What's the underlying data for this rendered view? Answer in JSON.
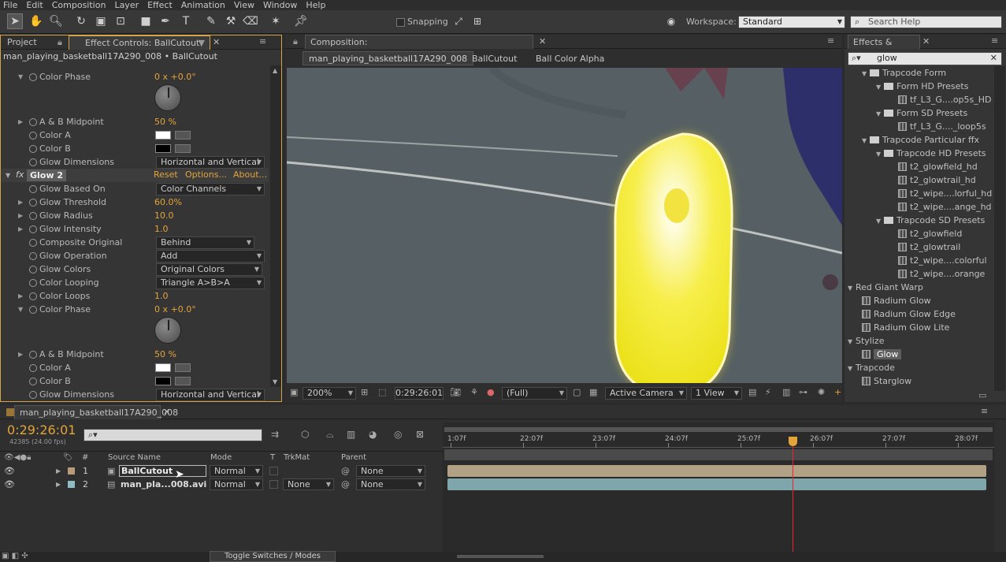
{
  "menu": [
    "File",
    "Edit",
    "Composition",
    "Layer",
    "Effect",
    "Animation",
    "View",
    "Window",
    "Help"
  ],
  "toolbar": {
    "snapping_label": "Snapping",
    "workspace_label": "Workspace:",
    "workspace_value": "Standard",
    "search_placeholder": "Search Help"
  },
  "effect_panel": {
    "tab_project": "Project",
    "tab_effect": "Effect Controls: BallCutout",
    "breadcrumb": "man_playing_basketball17A290_008 • BallCutout",
    "rows": [
      {
        "label": "Color Phase",
        "value": "0 x +0.0°"
      },
      {
        "label": "A & B Midpoint",
        "value": "50 %"
      },
      {
        "label": "Color A",
        "value": ""
      },
      {
        "label": "Color B",
        "value": ""
      },
      {
        "label": "Glow Dimensions",
        "value": "Horizontal and Vertical"
      }
    ],
    "glow2": {
      "name": "Glow 2",
      "reset": "Reset",
      "options": "Options...",
      "about": "About..."
    },
    "glow2_rows": [
      {
        "label": "Glow Based On",
        "value": "Color Channels"
      },
      {
        "label": "Glow Threshold",
        "value": "60.0%"
      },
      {
        "label": "Glow Radius",
        "value": "10.0"
      },
      {
        "label": "Glow Intensity",
        "value": "1.0"
      },
      {
        "label": "Composite Original",
        "value": "Behind"
      },
      {
        "label": "Glow Operation",
        "value": "Add"
      },
      {
        "label": "Glow Colors",
        "value": "Original Colors"
      },
      {
        "label": "Color Looping",
        "value": "Triangle A>B>A"
      },
      {
        "label": "Color Loops",
        "value": "1.0"
      },
      {
        "label": "Color Phase",
        "value": "0 x +0.0°"
      },
      {
        "label": "A & B Midpoint",
        "value": "50 %"
      },
      {
        "label": "Color A",
        "value": ""
      },
      {
        "label": "Color B",
        "value": ""
      },
      {
        "label": "Glow Dimensions",
        "value": "Horizontal and Vertical"
      }
    ]
  },
  "comp_panel": {
    "tab": "Composition: man_playing_basketball17A290_008",
    "crumbs": [
      "man_playing_basketball17A290_008",
      "BallCutout",
      "Ball Color Alpha"
    ],
    "zoom": "200%",
    "timecode": "0:29:26:01",
    "resolution": "(Full)",
    "camera": "Active Camera",
    "views": "1 View"
  },
  "ep_panel": {
    "tab": "Effects & Presets",
    "search": "glow",
    "items": [
      {
        "label": "Trapcode Form",
        "level": 1,
        "kind": "folder"
      },
      {
        "label": "Form HD Presets",
        "level": 2,
        "kind": "folder"
      },
      {
        "label": "tf_L3_G....op5s_HD",
        "level": 3,
        "kind": "preset"
      },
      {
        "label": "Form SD Presets",
        "level": 2,
        "kind": "folder"
      },
      {
        "label": "tf_L3_G...._loop5s",
        "level": 3,
        "kind": "preset"
      },
      {
        "label": "Trapcode Particular ffx",
        "level": 1,
        "kind": "folder"
      },
      {
        "label": "Trapcode HD Presets",
        "level": 2,
        "kind": "folder"
      },
      {
        "label": "t2_glowfield_hd",
        "level": 3,
        "kind": "preset"
      },
      {
        "label": "t2_glowtrail_hd",
        "level": 3,
        "kind": "preset"
      },
      {
        "label": "t2_wipe....lorful_hd",
        "level": 3,
        "kind": "preset"
      },
      {
        "label": "t2_wipe....ange_hd",
        "level": 3,
        "kind": "preset"
      },
      {
        "label": "Trapcode SD Presets",
        "level": 2,
        "kind": "folder"
      },
      {
        "label": "t2_glowfield",
        "level": 3,
        "kind": "preset"
      },
      {
        "label": "t2_glowtrail",
        "level": 3,
        "kind": "preset"
      },
      {
        "label": "t2_wipe....colorful",
        "level": 3,
        "kind": "preset"
      },
      {
        "label": "t2_wipe....orange",
        "level": 3,
        "kind": "preset"
      },
      {
        "label": "Red Giant Warp",
        "level": 0,
        "kind": "group"
      },
      {
        "label": "Radium Glow",
        "level": 1,
        "kind": "effect"
      },
      {
        "label": "Radium Glow Edge",
        "level": 1,
        "kind": "effect"
      },
      {
        "label": "Radium Glow Lite",
        "level": 1,
        "kind": "effect"
      },
      {
        "label": "Stylize",
        "level": 0,
        "kind": "group"
      },
      {
        "label": "Glow",
        "level": 1,
        "kind": "effect",
        "selected": true
      },
      {
        "label": "Trapcode",
        "level": 0,
        "kind": "group"
      },
      {
        "label": "Starglow",
        "level": 1,
        "kind": "effect"
      }
    ]
  },
  "timeline": {
    "tab": "man_playing_basketball17A290_008",
    "timecode": "0:29:26:01",
    "frames": "42385 (24.00 fps)",
    "headers": {
      "num": "#",
      "source": "Source Name",
      "mode": "Mode",
      "t": "T",
      "trkmat": "TrkMat",
      "parent": "Parent"
    },
    "ruler": [
      "1:07f",
      "22:07f",
      "23:07f",
      "24:07f",
      "25:07f",
      "26:07f",
      "27:07f",
      "28:07f"
    ],
    "layers": [
      {
        "num": "1",
        "name": "BallCutout",
        "mode": "Normal",
        "trkmat": "",
        "parent": "None"
      },
      {
        "num": "2",
        "name": "man_pla...008.avi",
        "mode": "Normal",
        "trkmat": "None",
        "parent": "None"
      }
    ],
    "toggle": "Toggle Switches / Modes"
  }
}
